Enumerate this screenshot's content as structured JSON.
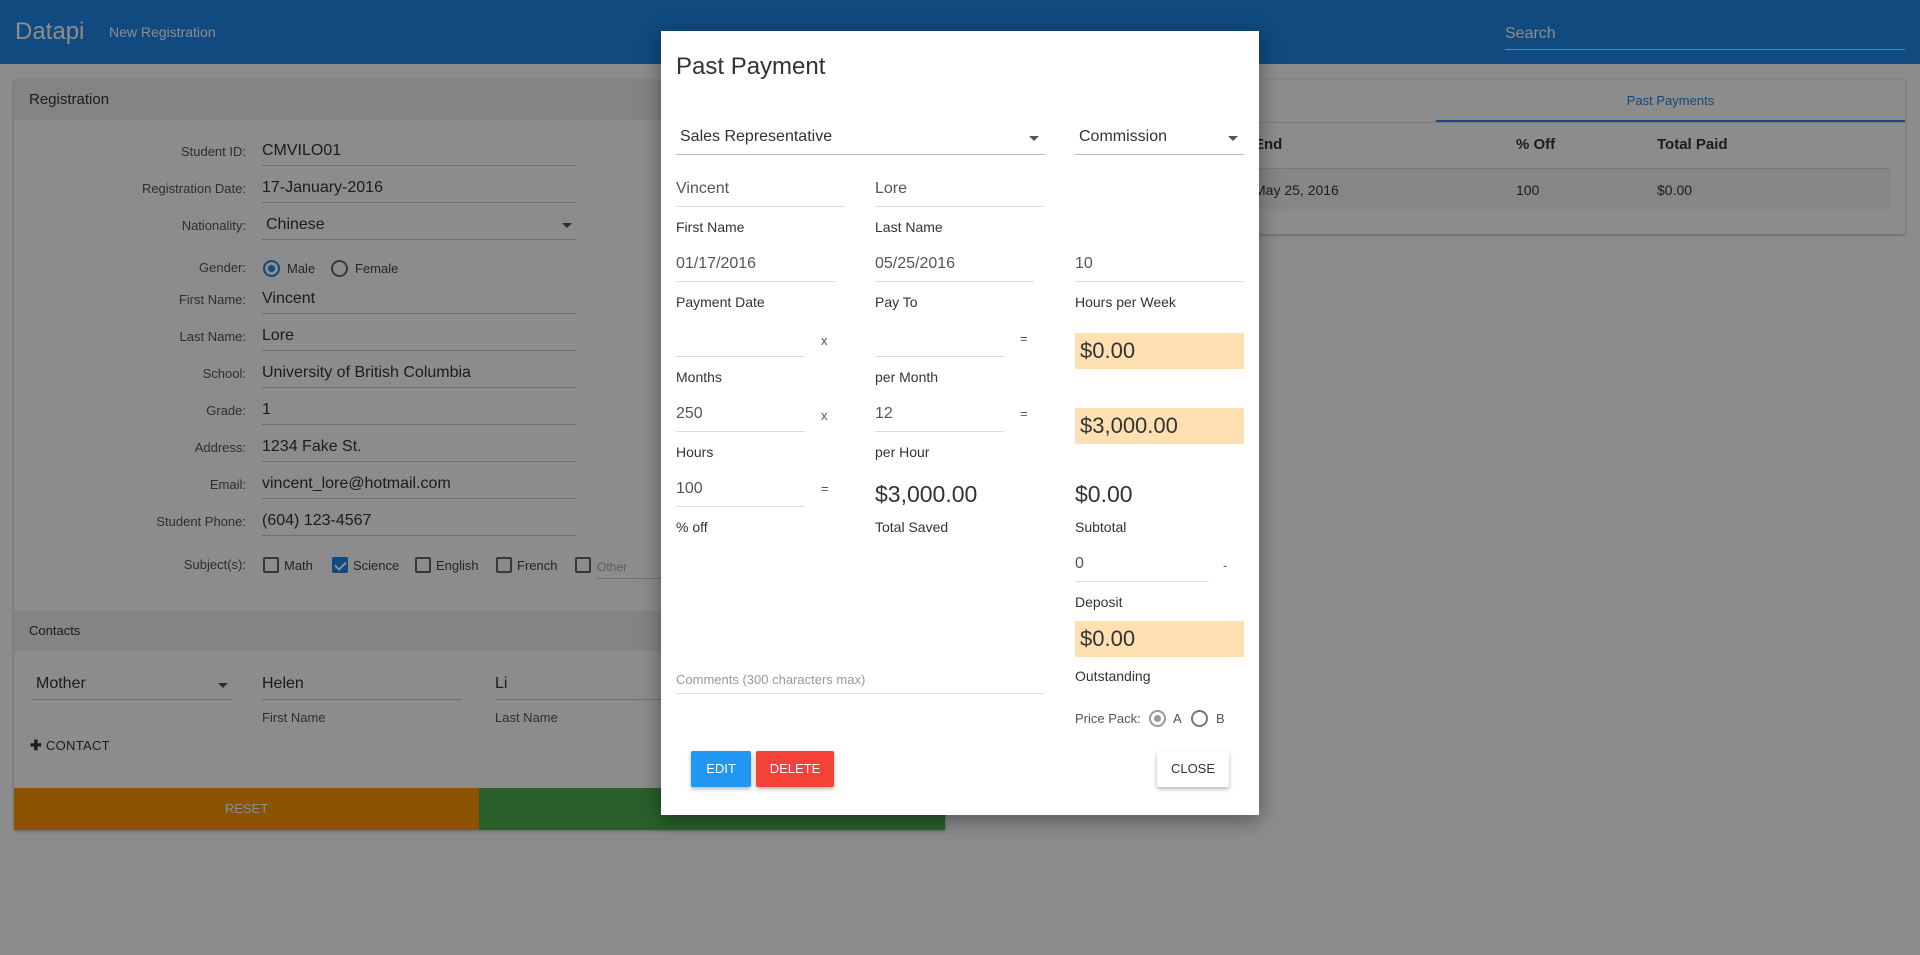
{
  "topbar": {
    "brand": "Datapi",
    "nav_link": "New Registration",
    "search_placeholder": "Search"
  },
  "registration": {
    "title": "Registration",
    "fields": {
      "student_id": {
        "label": "Student ID:",
        "value": "CMVILO01"
      },
      "registration_date": {
        "label": "Registration Date:",
        "value": "17-January-2016"
      },
      "nationality": {
        "label": "Nationality:",
        "value": "Chinese"
      },
      "gender": {
        "label": "Gender:",
        "options": [
          "Male",
          "Female"
        ],
        "selected": "Male"
      },
      "first_name": {
        "label": "First Name:",
        "value": "Vincent"
      },
      "last_name": {
        "label": "Last Name:",
        "value": "Lore"
      },
      "school": {
        "label": "School:",
        "value": "University of British Columbia"
      },
      "grade": {
        "label": "Grade:",
        "value": "1"
      },
      "address": {
        "label": "Address:",
        "value": "1234 Fake St."
      },
      "email": {
        "label": "Email:",
        "value": "vincent_lore@hotmail.com"
      },
      "student_phone": {
        "label": "Student Phone:",
        "value": "(604) 123-4567"
      },
      "subjects": {
        "label": "Subject(s):",
        "options": [
          "Math",
          "Science",
          "English",
          "French",
          "Other"
        ],
        "checked": [
          "Science"
        ]
      }
    },
    "contacts": {
      "title": "Contacts",
      "relation": "Mother",
      "first_name": "Helen",
      "first_name_label": "First Name",
      "last_name": "Li",
      "last_name_label": "Last Name",
      "add_label": "CONTACT"
    },
    "reset_label": "RESET"
  },
  "past_payments": {
    "tab": "Past Payments",
    "columns": [
      "End",
      "% Off",
      "Total Paid"
    ],
    "rows": [
      [
        "May 25, 2016",
        "100",
        "$0.00"
      ]
    ]
  },
  "modal": {
    "title": "Past Payment",
    "sales_rep": "Sales Representative",
    "commission": "Commission",
    "first_name": {
      "value": "Vincent",
      "label": "First Name"
    },
    "last_name": {
      "value": "Lore",
      "label": "Last Name"
    },
    "payment_date": {
      "value": "01/17/2016",
      "label": "Payment Date"
    },
    "pay_to": {
      "value": "05/25/2016",
      "label": "Pay To"
    },
    "hours_per_week": {
      "value": "10",
      "label": "Hours per Week"
    },
    "months": {
      "value": "",
      "label": "Months"
    },
    "per_month": {
      "value": "",
      "label": "per Month"
    },
    "monthly_total": "$0.00",
    "hours": {
      "value": "250",
      "label": "Hours"
    },
    "per_hour": {
      "value": "12",
      "label": "per Hour"
    },
    "hourly_total": "$3,000.00",
    "percent_off": {
      "value": "100",
      "label": "% off"
    },
    "total_saved": {
      "value": "$3,000.00",
      "label": "Total Saved"
    },
    "subtotal": {
      "value": "$0.00",
      "label": "Subtotal"
    },
    "deposit": {
      "value": "0",
      "label": "Deposit"
    },
    "outstanding": {
      "value": "$0.00",
      "label": "Outstanding"
    },
    "comments_placeholder": "Comments (300 characters max)",
    "price_pack": {
      "label": "Price Pack:",
      "options": [
        "A",
        "B"
      ],
      "selected": "A"
    },
    "ops": {
      "times": "x",
      "equals": "=",
      "minus": "-"
    },
    "buttons": {
      "edit": "EDIT",
      "delete": "DELETE",
      "close": "CLOSE"
    }
  },
  "colors": {
    "primary": "#1e88e5",
    "reset": "#ff9800",
    "register": "#4caf50",
    "edit": "#2196f3",
    "delete": "#f44336",
    "highlight": "#ffe0b2"
  },
  "icons": [
    "calendar-icon",
    "chevron-down-icon",
    "plus-icon"
  ]
}
